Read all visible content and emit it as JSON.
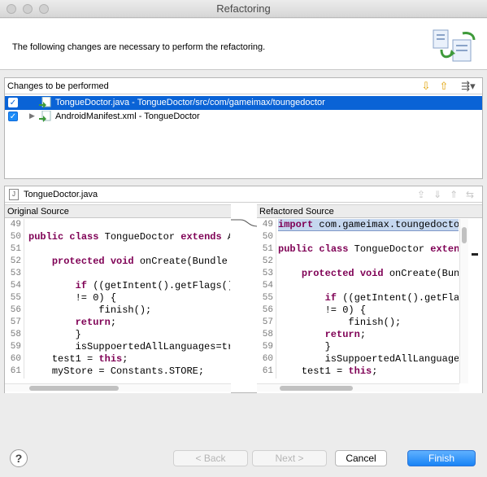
{
  "window": {
    "title": "Refactoring"
  },
  "header": {
    "message": "The following changes are necessary to perform the refactoring."
  },
  "changes": {
    "title": "Changes to be performed",
    "items": [
      {
        "label": "TongueDoctor.java - TongueDoctor/src/com/gameimax/toungedoctor",
        "checked": true,
        "selected": true
      },
      {
        "label": "AndroidManifest.xml - TongueDoctor",
        "checked": true,
        "selected": false
      }
    ]
  },
  "compare": {
    "file": "TongueDoctor.java",
    "original": {
      "title": "Original Source",
      "line_numbers": [
        "49",
        "50",
        "51",
        "52",
        "53",
        "54",
        "55",
        "56",
        "57",
        "58",
        "59",
        "60",
        "61"
      ],
      "lines": [
        "",
        "public class TongueDoctor extends Ac",
        "",
        "    protected void onCreate(Bundle sa",
        "",
        "        if ((getIntent().getFlags()",
        "        != 0) {",
        "            finish();",
        "        return;",
        "        }",
        "        isSuppoertedAllLanguages=tru",
        "    test1 = this;",
        "    myStore = Constants.STORE;"
      ]
    },
    "refactored": {
      "title": "Refactored Source",
      "line_numbers": [
        "49",
        "50",
        "51",
        "52",
        "53",
        "54",
        "55",
        "56",
        "57",
        "58",
        "59",
        "60",
        "61"
      ],
      "lines": [
        "import com.gameimax.toungedoctor",
        "",
        "public class TongueDoctor extends",
        "",
        "    protected void onCreate(Bund",
        "",
        "        if ((getIntent().getFla",
        "        != 0) {",
        "            finish();",
        "        return;",
        "        }",
        "        isSuppoertedAllLanguage",
        "    test1 = this;"
      ]
    }
  },
  "buttons": {
    "help": "?",
    "back": "< Back",
    "next": "Next >",
    "cancel": "Cancel",
    "finish": "Finish"
  },
  "colors": {
    "selection": "#0a63d6",
    "keyword": "#7f0055",
    "primary_button": "#1983f5"
  }
}
